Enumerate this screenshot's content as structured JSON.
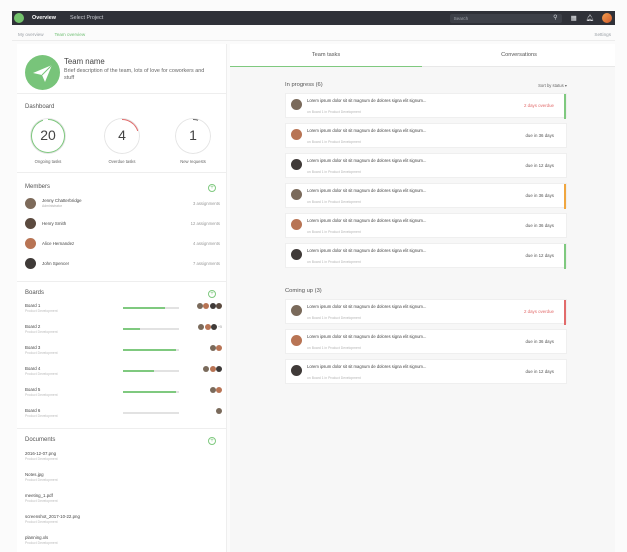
{
  "topbar": {
    "nav": [
      "Overview",
      "Select Project"
    ],
    "search_placeholder": "Search"
  },
  "subnav": {
    "items": [
      "My overview",
      "Team overview"
    ],
    "settings": "Settings"
  },
  "team": {
    "name": "Team name",
    "description": "Brief description of the team, lots of love for coworkers and stuff"
  },
  "dashboard": {
    "title": "Dashboard",
    "gauges": [
      {
        "value": "20",
        "label": "Ongoing tasks",
        "color": "#7fc97f",
        "progress": 0.95
      },
      {
        "value": "4",
        "label": "Overdue tasks",
        "color": "#e26b6b",
        "progress": 0.2
      },
      {
        "value": "1",
        "label": "New requests",
        "color": "#6b6b6b",
        "progress": 0.05
      }
    ]
  },
  "members": {
    "title": "Members",
    "items": [
      {
        "name": "Jenny Chatterbridge",
        "role": "Administrator",
        "count": "3 assignments",
        "color": "#7d6a5a"
      },
      {
        "name": "Henry Smith",
        "role": "",
        "count": "12 assignments",
        "color": "#5b4a3f"
      },
      {
        "name": "Alice Hernandez",
        "role": "",
        "count": "4 assignments",
        "color": "#b87454"
      },
      {
        "name": "John Spencer",
        "role": "",
        "count": "7 assignments",
        "color": "#3f3a38"
      }
    ]
  },
  "boards": {
    "title": "Boards",
    "items": [
      {
        "name": "Board 1",
        "sub": "Product Development",
        "progress": 0.75,
        "avatars": 4,
        "more": ""
      },
      {
        "name": "Board 2",
        "sub": "Product Development",
        "progress": 0.3,
        "avatars": 3,
        "more": "+5"
      },
      {
        "name": "Board 3",
        "sub": "Product Development",
        "progress": 0.95,
        "avatars": 2,
        "more": ""
      },
      {
        "name": "Board 4",
        "sub": "Product Development",
        "progress": 0.55,
        "avatars": 3,
        "more": ""
      },
      {
        "name": "Board 5",
        "sub": "Product Development",
        "progress": 0.95,
        "avatars": 2,
        "more": ""
      },
      {
        "name": "Board 6",
        "sub": "Product Development",
        "progress": 0.0,
        "avatars": 1,
        "more": ""
      }
    ]
  },
  "documents": {
    "title": "Documents",
    "items": [
      {
        "name": "2016-12-07.png",
        "sub": "Product Development"
      },
      {
        "name": "Notes.jpg",
        "sub": "Product Development"
      },
      {
        "name": "meeting_1.pdf",
        "sub": "Product Development"
      },
      {
        "name": "screenshot_2017-10-22.png",
        "sub": "Product Development"
      },
      {
        "name": "planning.xls",
        "sub": "Product Development"
      }
    ]
  },
  "right": {
    "tabs": [
      "Team tasks",
      "Conversations"
    ],
    "groups": [
      {
        "title": "In progress (6)",
        "sort": "Sort by status",
        "tasks": [
          {
            "text": "Lorem ipsum dolor sit sit magnum de dolores signa elit signum...",
            "sub": "on Board 1 in Product Development",
            "due": "2 days overdue",
            "overdue": true,
            "strip": "#7fc97f",
            "color": "#7a6a5b"
          },
          {
            "text": "Lorem ipsum dolor sit sit magnum de dolores signa elit signum...",
            "sub": "on Board 1 in Product Development",
            "due": "due in 36 days",
            "overdue": false,
            "strip": "",
            "color": "#b87454"
          },
          {
            "text": "Lorem ipsum dolor sit sit magnum de dolores signa elit signum...",
            "sub": "on Board 1 in Product Development",
            "due": "due in 12 days",
            "overdue": false,
            "strip": "",
            "color": "#3f3a38"
          },
          {
            "text": "Lorem ipsum dolor sit sit magnum de dolores signa elit signum...",
            "sub": "on Board 1 in Product Development",
            "due": "due in 36 days",
            "overdue": false,
            "strip": "#f0a63f",
            "color": "#7a6a5b"
          },
          {
            "text": "Lorem ipsum dolor sit sit magnum de dolores signa elit signum...",
            "sub": "on Board 1 in Product Development",
            "due": "due in 36 days",
            "overdue": false,
            "strip": "",
            "color": "#b87454"
          },
          {
            "text": "Lorem ipsum dolor sit sit magnum de dolores signa elit signum...",
            "sub": "on Board 1 in Product Development",
            "due": "due in 12 days",
            "overdue": false,
            "strip": "#7fc97f",
            "color": "#3f3a38"
          }
        ]
      },
      {
        "title": "Coming up (3)",
        "sort": "",
        "tasks": [
          {
            "text": "Lorem ipsum dolor sit sit magnum de dolores signa elit signum...",
            "sub": "on Board 1 in Product Development",
            "due": "2 days overdue",
            "overdue": true,
            "strip": "#e26b6b",
            "color": "#7a6a5b"
          },
          {
            "text": "Lorem ipsum dolor sit sit magnum de dolores signa elit signum...",
            "sub": "on Board 1 in Product Development",
            "due": "due in 36 days",
            "overdue": false,
            "strip": "",
            "color": "#b87454"
          },
          {
            "text": "Lorem ipsum dolor sit sit magnum de dolores signa elit signum...",
            "sub": "on Board 1 in Product Development",
            "due": "due in 12 days",
            "overdue": false,
            "strip": "",
            "color": "#3f3a38"
          }
        ]
      }
    ]
  }
}
